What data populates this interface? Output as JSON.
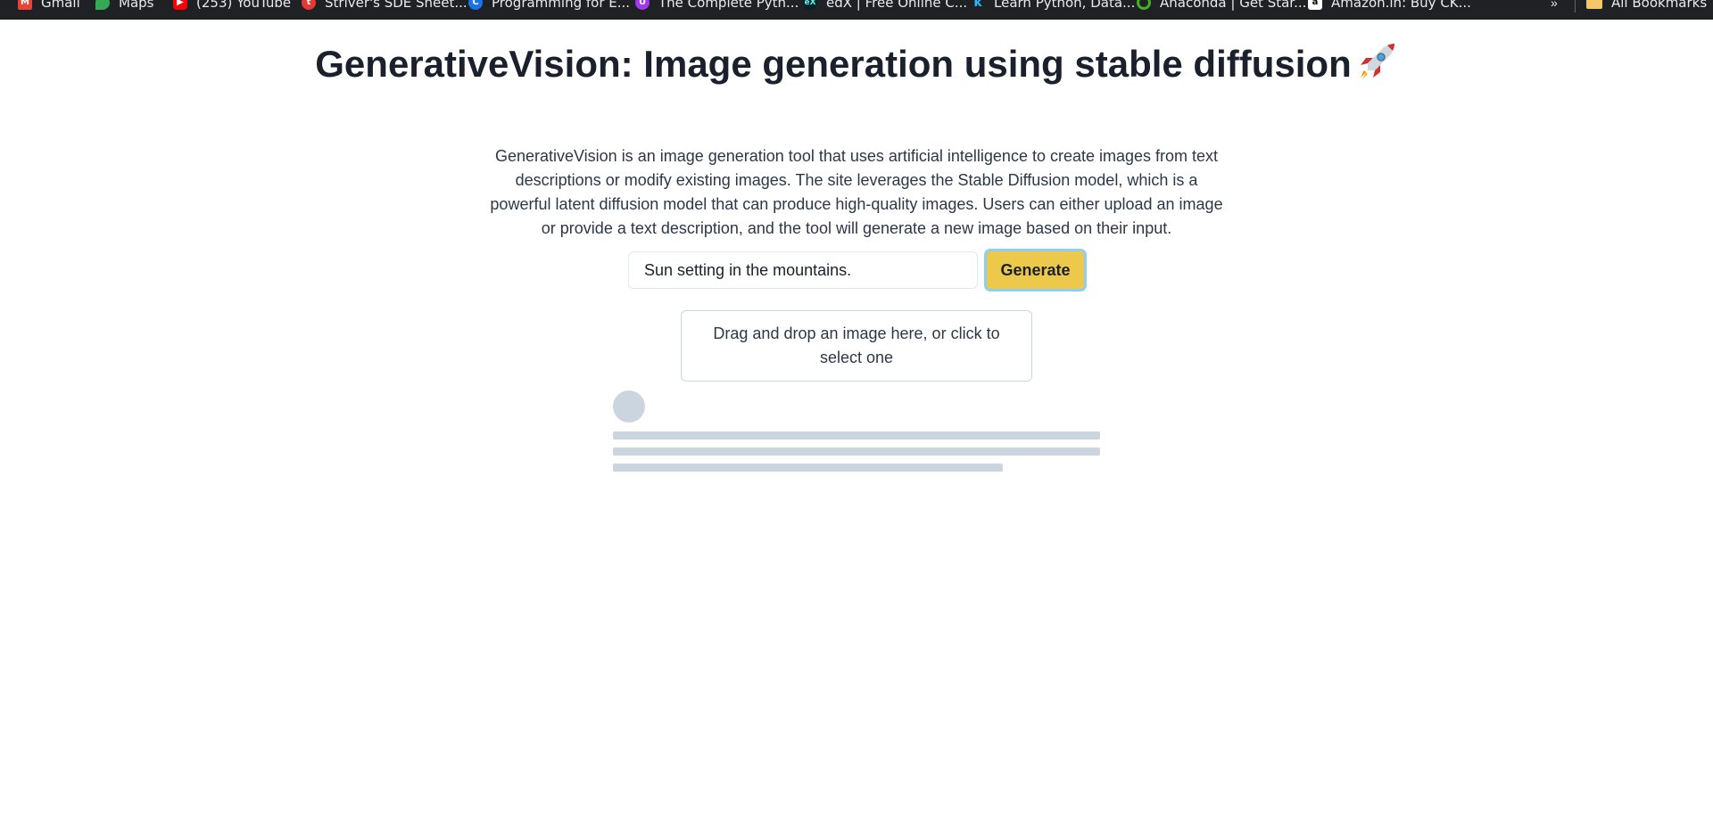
{
  "bookmarks": [
    {
      "label": "Gmail",
      "icon": "gmail-icon",
      "color": "#ea4335"
    },
    {
      "label": "Maps",
      "icon": "maps-icon",
      "color": "#34a853"
    },
    {
      "label": "(253) YouTube",
      "icon": "youtube-icon",
      "color": "#ff0000"
    },
    {
      "label": "Striver's SDE Sheet...",
      "icon": "takeuforward-icon",
      "color": "#e53935"
    },
    {
      "label": "Programming for E...",
      "icon": "coursera-icon",
      "color": "#1a73e8"
    },
    {
      "label": "The Complete Pyth...",
      "icon": "udemy-icon",
      "color": "#a435f0"
    },
    {
      "label": "edX | Free Online C...",
      "icon": "edx-icon",
      "color": "#02262b"
    },
    {
      "label": "Learn Python, Data...",
      "icon": "kaggle-icon",
      "color": "#20beff"
    },
    {
      "label": "Anaconda | Get Star...",
      "icon": "anaconda-icon",
      "color": "#43b02a"
    },
    {
      "label": "Amazon.in: Buy CK...",
      "icon": "amazon-icon",
      "color": "#ffffff"
    }
  ],
  "bookmarks_overflow": "»",
  "all_bookmarks": "All Bookmarks",
  "page": {
    "title": "GenerativeVision: Image generation using stable diffusion",
    "description": "GenerativeVision is an image generation tool that uses artificial intelligence to create images from text descriptions or modify existing images. The site leverages the Stable Diffusion model, which is a powerful latent diffusion model that can produce high-quality images. Users can either upload an image or provide a text description, and the tool will generate a new image based on their input.",
    "prompt_value": "Sun setting in the mountains.",
    "generate_label": "Generate",
    "dropzone_text": "Drag and drop an image here, or click to select one"
  },
  "colors": {
    "generate_button": "#ecc94b",
    "skeleton": "#cbd5e0",
    "bookmarks_bar": "#202124"
  }
}
